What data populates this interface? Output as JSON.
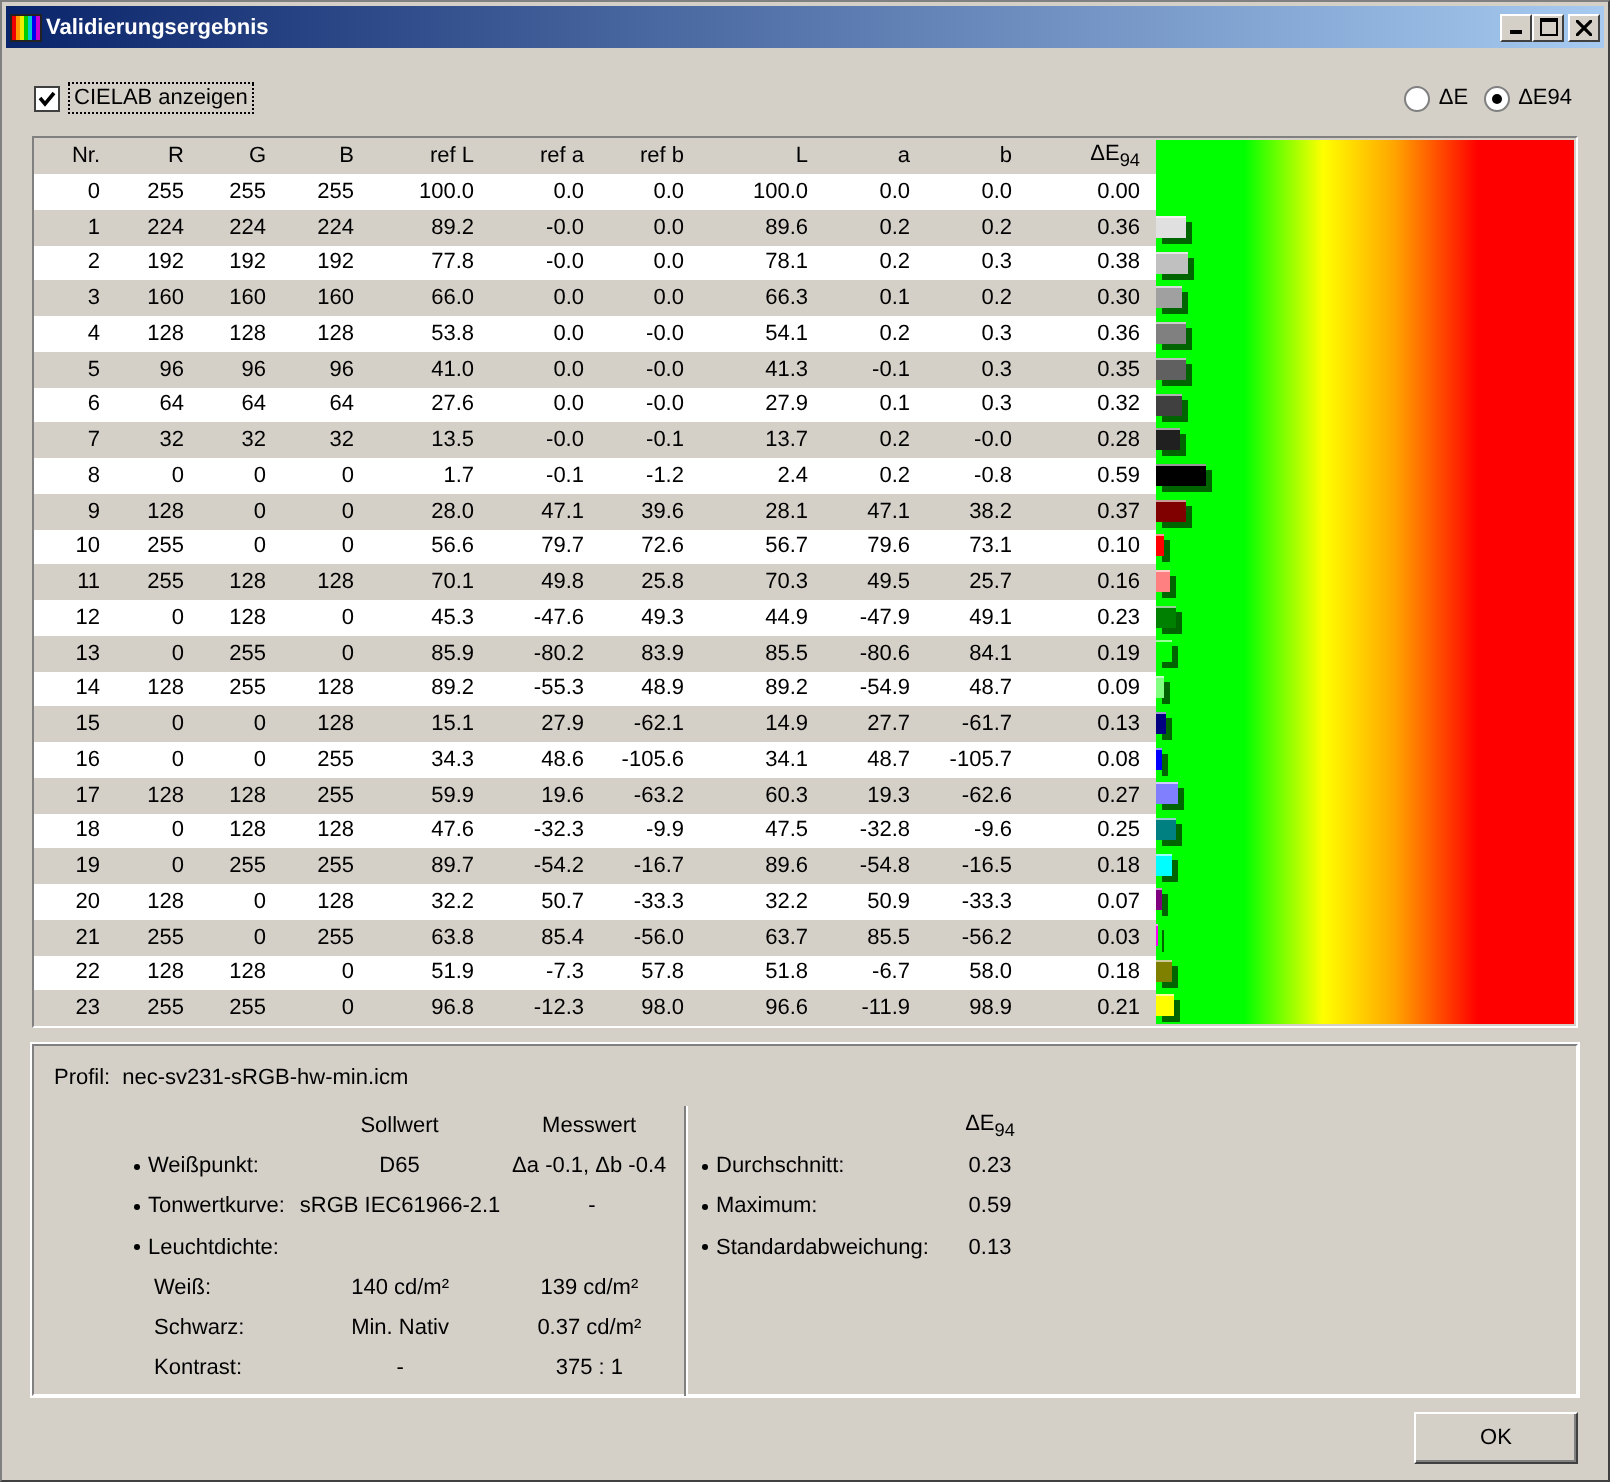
{
  "window": {
    "title": "Validierungsergebnis"
  },
  "show_cielab": {
    "label": "CIELAB anzeigen",
    "checked": true
  },
  "metric_options": [
    {
      "label": "ΔE",
      "selected": false
    },
    {
      "label": "ΔE94",
      "selected": true
    }
  ],
  "table": {
    "columns": [
      "Nr.",
      "R",
      "G",
      "B",
      "ref L",
      "ref a",
      "ref b",
      "L",
      "a",
      "b",
      "ΔE$_{94}$"
    ],
    "rows": [
      {
        "cells": [
          "0",
          "255",
          "255",
          "255",
          "100.0",
          "0.0",
          "0.0",
          "100.0",
          "0.0",
          "0.0",
          "0.00"
        ]
      },
      {
        "cells": [
          "1",
          "224",
          "224",
          "224",
          "89.2",
          "-0.0",
          "0.0",
          "89.6",
          "0.2",
          "0.2",
          "0.36"
        ],
        "color": "#e0e0e0",
        "level": 0.072
      },
      {
        "cells": [
          "2",
          "192",
          "192",
          "192",
          "77.8",
          "-0.0",
          "0.0",
          "78.1",
          "0.2",
          "0.3",
          "0.38"
        ],
        "color": "#c0c0c0",
        "level": 0.076
      },
      {
        "cells": [
          "3",
          "160",
          "160",
          "160",
          "66.0",
          "0.0",
          "0.0",
          "66.3",
          "0.1",
          "0.2",
          "0.30"
        ],
        "color": "#a0a0a0",
        "level": 0.06
      },
      {
        "cells": [
          "4",
          "128",
          "128",
          "128",
          "53.8",
          "0.0",
          "-0.0",
          "54.1",
          "0.2",
          "0.3",
          "0.36"
        ],
        "color": "#808080",
        "level": 0.072
      },
      {
        "cells": [
          "5",
          "96",
          "96",
          "96",
          "41.0",
          "0.0",
          "-0.0",
          "41.3",
          "-0.1",
          "0.3",
          "0.35"
        ],
        "color": "#606060",
        "level": 0.07
      },
      {
        "cells": [
          "6",
          "64",
          "64",
          "64",
          "27.6",
          "0.0",
          "-0.0",
          "27.9",
          "0.1",
          "0.3",
          "0.32"
        ],
        "color": "#404040",
        "level": 0.064
      },
      {
        "cells": [
          "7",
          "32",
          "32",
          "32",
          "13.5",
          "-0.0",
          "-0.1",
          "13.7",
          "0.2",
          "-0.0",
          "0.28"
        ],
        "color": "#202020",
        "level": 0.056
      },
      {
        "cells": [
          "8",
          "0",
          "0",
          "0",
          "1.7",
          "-0.1",
          "-1.2",
          "2.4",
          "0.2",
          "-0.8",
          "0.59"
        ],
        "color": "#000000",
        "level": 0.118
      },
      {
        "cells": [
          "9",
          "128",
          "0",
          "0",
          "28.0",
          "47.1",
          "39.6",
          "28.1",
          "47.1",
          "38.2",
          "0.37"
        ],
        "color": "#800000",
        "level": 0.074
      },
      {
        "cells": [
          "10",
          "255",
          "0",
          "0",
          "56.6",
          "79.7",
          "72.6",
          "56.7",
          "79.6",
          "73.1",
          "0.10"
        ],
        "color": "#ff0000",
        "level": 0.02
      },
      {
        "cells": [
          "11",
          "255",
          "128",
          "128",
          "70.1",
          "49.8",
          "25.8",
          "70.3",
          "49.5",
          "25.7",
          "0.16"
        ],
        "color": "#ff8080",
        "level": 0.032
      },
      {
        "cells": [
          "12",
          "0",
          "128",
          "0",
          "45.3",
          "-47.6",
          "49.3",
          "44.9",
          "-47.9",
          "49.1",
          "0.23"
        ],
        "color": "#008000",
        "level": 0.046
      },
      {
        "cells": [
          "13",
          "0",
          "255",
          "0",
          "85.9",
          "-80.2",
          "83.9",
          "85.5",
          "-80.6",
          "84.1",
          "0.19"
        ],
        "color": "#00ff00",
        "level": 0.038
      },
      {
        "cells": [
          "14",
          "128",
          "255",
          "128",
          "89.2",
          "-55.3",
          "48.9",
          "89.2",
          "-54.9",
          "48.7",
          "0.09"
        ],
        "color": "#80ff80",
        "level": 0.018
      },
      {
        "cells": [
          "15",
          "0",
          "0",
          "128",
          "15.1",
          "27.9",
          "-62.1",
          "14.9",
          "27.7",
          "-61.7",
          "0.13"
        ],
        "color": "#000080",
        "level": 0.026
      },
      {
        "cells": [
          "16",
          "0",
          "0",
          "255",
          "34.3",
          "48.6",
          "-105.6",
          "34.1",
          "48.7",
          "-105.7",
          "0.08"
        ],
        "color": "#0000ff",
        "level": 0.016
      },
      {
        "cells": [
          "17",
          "128",
          "128",
          "255",
          "59.9",
          "19.6",
          "-63.2",
          "60.3",
          "19.3",
          "-62.6",
          "0.27"
        ],
        "color": "#8080ff",
        "level": 0.054
      },
      {
        "cells": [
          "18",
          "0",
          "128",
          "128",
          "47.6",
          "-32.3",
          "-9.9",
          "47.5",
          "-32.8",
          "-9.6",
          "0.25"
        ],
        "color": "#008080",
        "level": 0.05
      },
      {
        "cells": [
          "19",
          "0",
          "255",
          "255",
          "89.7",
          "-54.2",
          "-16.7",
          "89.6",
          "-54.8",
          "-16.5",
          "0.18"
        ],
        "color": "#00ffff",
        "level": 0.036
      },
      {
        "cells": [
          "20",
          "128",
          "0",
          "128",
          "32.2",
          "50.7",
          "-33.3",
          "32.2",
          "50.9",
          "-33.3",
          "0.07"
        ],
        "color": "#800080",
        "level": 0.014
      },
      {
        "cells": [
          "21",
          "255",
          "0",
          "255",
          "63.8",
          "85.4",
          "-56.0",
          "63.7",
          "85.5",
          "-56.2",
          "0.03"
        ],
        "color": "#ff00ff",
        "level": 0.006
      },
      {
        "cells": [
          "22",
          "128",
          "128",
          "0",
          "51.9",
          "-7.3",
          "57.8",
          "51.8",
          "-6.7",
          "58.0",
          "0.18"
        ],
        "color": "#808000",
        "level": 0.036
      },
      {
        "cells": [
          "23",
          "255",
          "255",
          "0",
          "96.8",
          "-12.3",
          "98.0",
          "96.6",
          "-11.9",
          "98.9",
          "0.21"
        ],
        "color": "#ffff00",
        "level": 0.042
      }
    ]
  },
  "summary": {
    "profile_label": "Profil:",
    "profile": "nec-sv231-sRGB-hw-min.icm",
    "headers": [
      "Sollwert",
      "Messwert"
    ],
    "items": [
      {
        "label": "Weißpunkt:",
        "target": "D65",
        "measured": "Δa -0.1, Δb -0.4"
      },
      {
        "label": "Tonwertkurve:",
        "target": "sRGB IEC61966-2.1",
        "measured": "-"
      },
      {
        "label": "Leuchtdichte:",
        "children": [
          {
            "label": "Weiß:",
            "target": "140 cd/m²",
            "measured": "139 cd/m²"
          },
          {
            "label": "Schwarz:",
            "target": "Min. Nativ",
            "measured": "0.37 cd/m²"
          },
          {
            "label": "Kontrast:",
            "target": "-",
            "measured": "375 : 1"
          }
        ]
      }
    ],
    "delta_header": "ΔE$_{94}$",
    "stats": [
      {
        "label": "Durchschnitt:",
        "value": "0.23"
      },
      {
        "label": "Maximum:",
        "value": "0.59"
      },
      {
        "label": "Standardabweichung:",
        "value": "0.13"
      }
    ]
  },
  "buttons": [
    "OK"
  ]
}
